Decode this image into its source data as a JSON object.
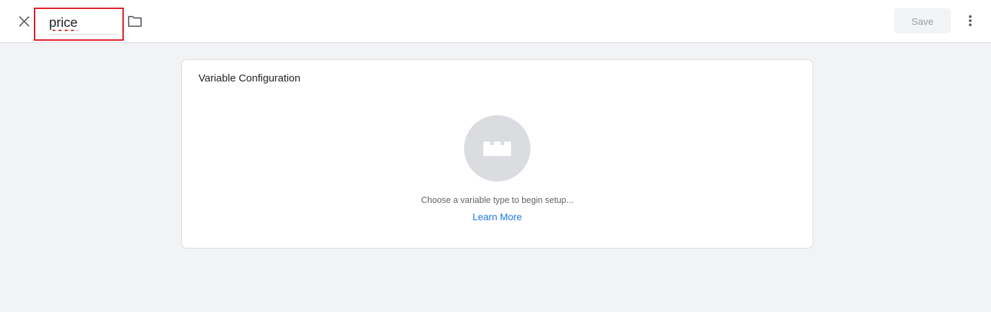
{
  "header": {
    "close_icon": "close-icon",
    "name_value": "price",
    "folder_icon": "folder-icon",
    "save_label": "Save",
    "more_icon": "more-vert-icon"
  },
  "config_card": {
    "title": "Variable Configuration",
    "type_icon": "brick-icon",
    "hint": "Choose a variable type to begin setup...",
    "learn_more": "Learn More"
  },
  "colors": {
    "highlight_border": "#e0141e",
    "link": "#1a73e8",
    "background": "#f1f3f4"
  }
}
